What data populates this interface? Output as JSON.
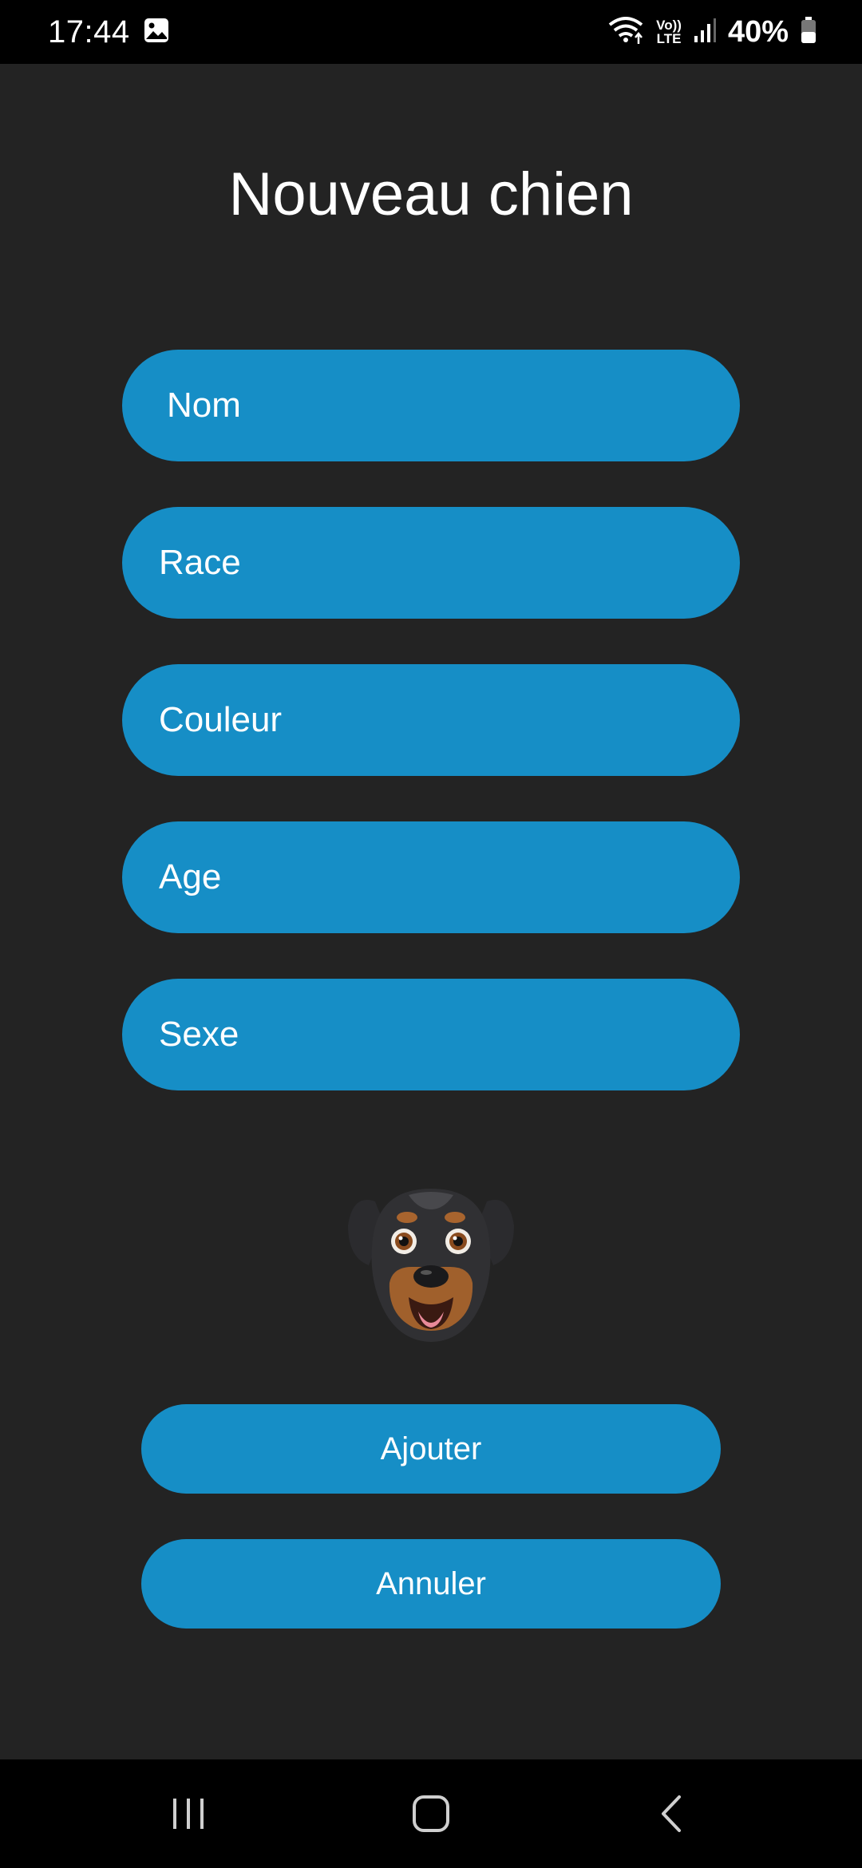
{
  "status_bar": {
    "time": "17:44",
    "volte_top": "Vo))",
    "volte_bottom": "LTE",
    "battery": "40%",
    "icons": [
      "gallery-notification-icon",
      "wifi-icon",
      "volte-icon",
      "signal-icon",
      "battery-icon"
    ]
  },
  "form": {
    "title": "Nouveau chien",
    "fields": {
      "nom": {
        "placeholder": "Nom",
        "value": ""
      },
      "race": {
        "placeholder": "Race",
        "value": ""
      },
      "couleur": {
        "placeholder": "Couleur",
        "value": ""
      },
      "age": {
        "placeholder": "Age",
        "value": ""
      },
      "sexe": {
        "placeholder": "Sexe",
        "value": ""
      }
    },
    "image": "rottweiler-dog-emoji",
    "buttons": {
      "add": "Ajouter",
      "cancel": "Annuler"
    }
  },
  "nav_bar": {
    "icons": [
      "recent-apps-icon",
      "home-icon",
      "back-icon"
    ]
  },
  "colors": {
    "background": "#232323",
    "accent": "#168ec6",
    "bars": "#000000"
  }
}
